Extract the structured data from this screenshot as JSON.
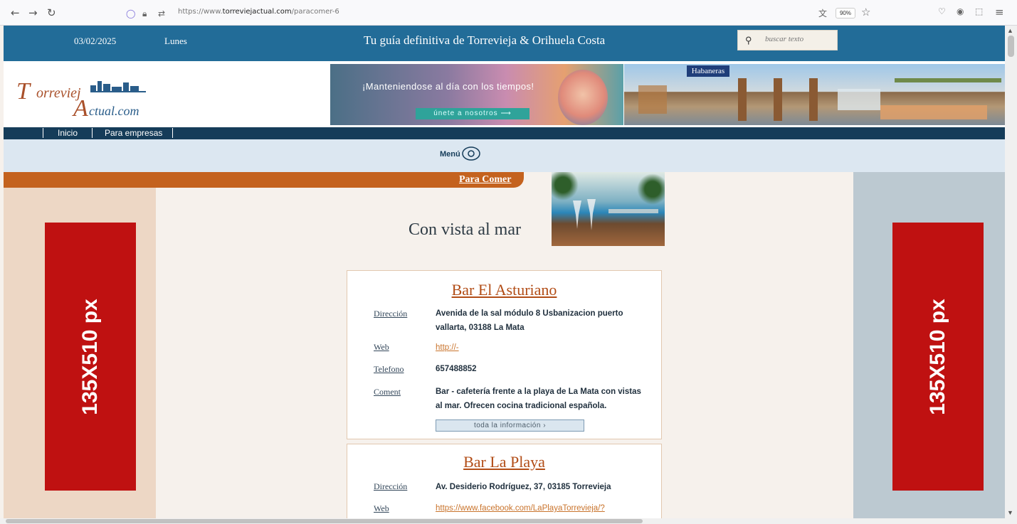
{
  "browser": {
    "url_prefix": "https://www.",
    "url_domain": "torreviejactual.com",
    "url_path": "/paracomer-6",
    "zoom": "90%"
  },
  "topbar": {
    "date": "03/02/2025",
    "day": "Lunes",
    "tagline": "Tu guía definitiva de Torrevieja & Orihuela Costa",
    "search_placeholder": "buscar texto"
  },
  "logo": {
    "part1": "T",
    "part1_rest": "orreviej",
    "part2": "A",
    "part2_rest": "ctual.com"
  },
  "banners": {
    "promo_text": "¡Manteniendose al día con los tiempos!",
    "promo_button": "únete a nosotros ⟶",
    "shop_sign": "Habaneras"
  },
  "nav": {
    "items": [
      "Inicio",
      "Para empresas"
    ]
  },
  "menu": {
    "label": "Menú"
  },
  "category": {
    "link": "Para Comer",
    "heading": "Con vista al mar"
  },
  "ads": {
    "left": "135X510 px",
    "right": "135X510 px"
  },
  "listings": [
    {
      "name": "Bar El Asturiano",
      "labels": {
        "address": "Dirección",
        "web": "Web",
        "phone": "Telefono",
        "comment": "Coment"
      },
      "address": "Avenida de la sal módulo 8 Usbanizacion puerto vallarta, 03188 La Mata",
      "web": "http://-",
      "phone": "657488852",
      "comment": "Bar - cafetería frente a la playa de La Mata con vistas al mar. Ofrecen cocina tradicional española.",
      "more": "toda la información ›"
    },
    {
      "name": "Bar La Playa",
      "labels": {
        "address": "Dirección",
        "web": "Web"
      },
      "address": "Av. Desiderio Rodríguez, 37, 03185 Torrevieja",
      "web": "https://www.facebook.com/LaPlayaTorrevieja/?"
    }
  ]
}
